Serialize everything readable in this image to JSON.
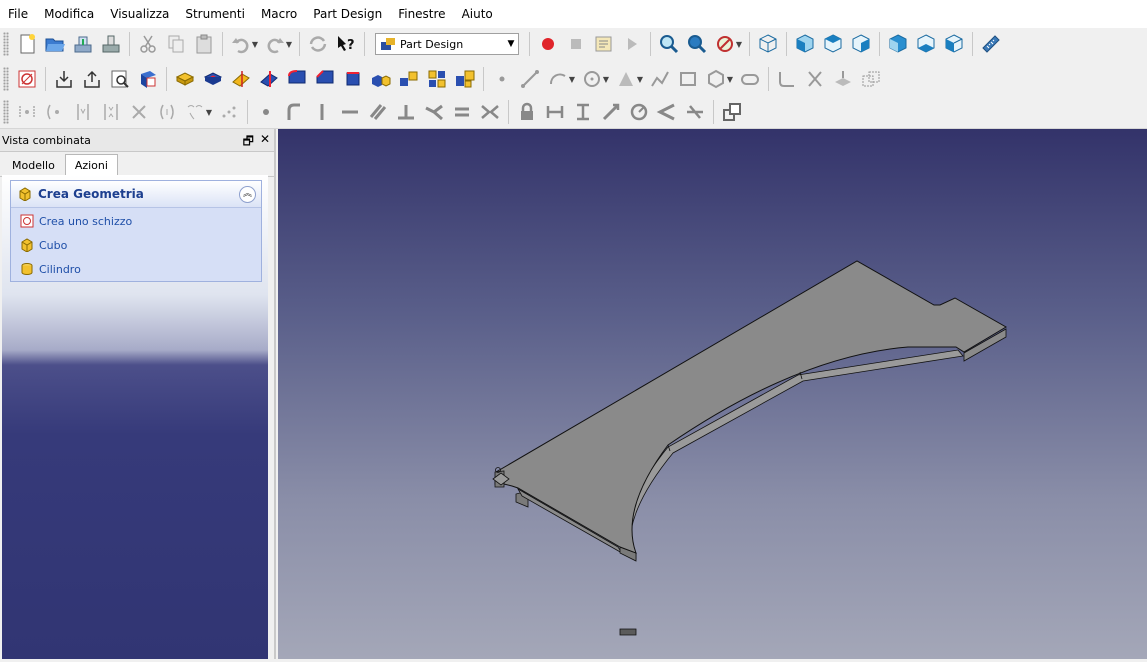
{
  "menubar": {
    "items": [
      "File",
      "Modifica",
      "Visualizza",
      "Strumenti",
      "Macro",
      "Part Design",
      "Finestre",
      "Aiuto"
    ]
  },
  "toolbar": {
    "workbench_selector": "Part Design"
  },
  "combo_view": {
    "title": "Vista combinata",
    "tabs": [
      "Modello",
      "Azioni"
    ],
    "active_tab": "Azioni"
  },
  "task_panel": {
    "title": "Crea Geometria",
    "items": [
      {
        "label": "Crea uno schizzo",
        "icon": "sketch-icon"
      },
      {
        "label": "Cubo",
        "icon": "cube-icon"
      },
      {
        "label": "Cilindro",
        "icon": "cylinder-icon"
      }
    ]
  },
  "colors": {
    "accent": "#1f4fa8",
    "viewport_top": "#33336a",
    "viewport_bottom": "#a4a7b8",
    "part_face": "#8a8a8a"
  }
}
